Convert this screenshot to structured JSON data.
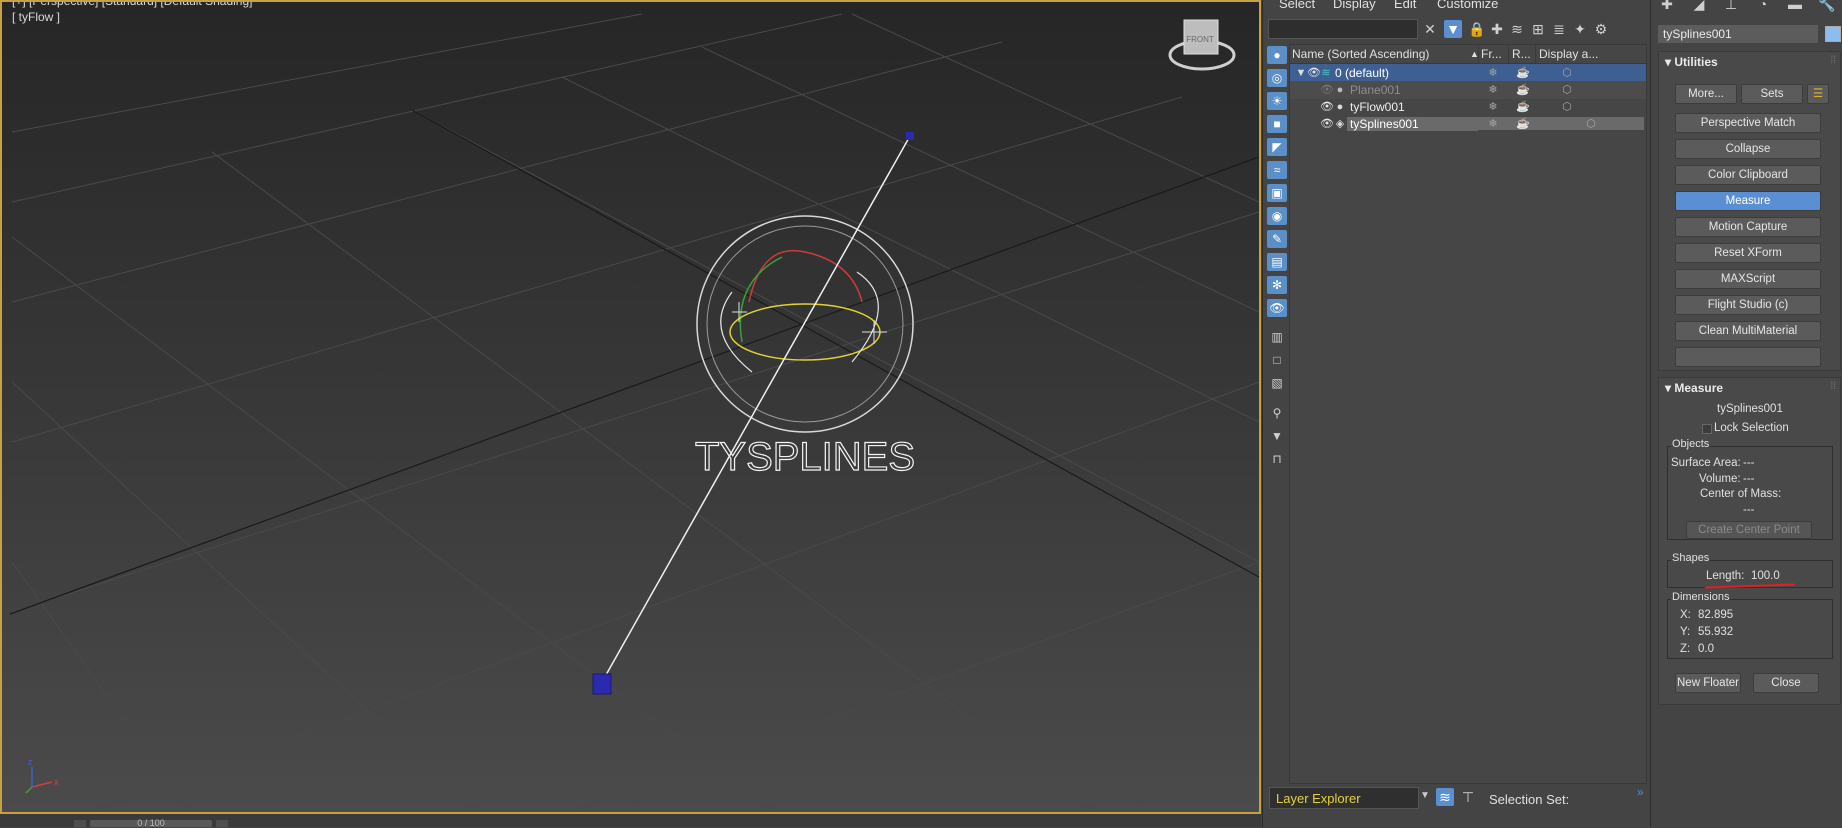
{
  "viewport": {
    "labels_line": "[+] [Perspective] [Standard] [Default Shading]",
    "label": "[ tyFlow ]",
    "logo_text": "TYSPLINES",
    "frame_counter": "0 / 100",
    "viewcube_text": "FRONT",
    "axis_labels": {
      "x": "x",
      "y": "y",
      "z": "z"
    }
  },
  "explorer": {
    "menu": [
      "Select",
      "Display",
      "Edit",
      "Customize"
    ],
    "search_placeholder": "",
    "columns": {
      "name": "Name (Sorted Ascending)",
      "frozen": "Fr...",
      "render": "R...",
      "display": "Display a..."
    },
    "rows": [
      {
        "name": "0 (default)",
        "level": 0,
        "type": "layer"
      },
      {
        "name": "Plane001",
        "level": 1,
        "type": "geometry",
        "hidden": true
      },
      {
        "name": "tyFlow001",
        "level": 1,
        "type": "geometry"
      },
      {
        "name": "tySplines001",
        "level": 1,
        "type": "shape",
        "selected": true
      }
    ],
    "layer_dropdown": "Layer Explorer",
    "selection_set_label": "Selection Set:"
  },
  "command_panel": {
    "object_name": "tySplines001",
    "swatch_color": "#8cbcf0",
    "utilities": {
      "title": "Utilities",
      "more_button": "More...",
      "sets_button": "Sets",
      "buttons": [
        "Perspective Match",
        "Collapse",
        "Color Clipboard",
        "Measure",
        "Motion Capture",
        "Reset XForm",
        "MAXScript",
        "Flight Studio (c)",
        "Clean MultiMaterial",
        ""
      ],
      "selected_button": "Measure"
    },
    "measure": {
      "title": "Measure",
      "object": "tySplines001",
      "lock_selection": "Lock Selection",
      "objects_group": "Objects",
      "surface_area_label": "Surface Area:",
      "surface_area_value": "---",
      "volume_label": "Volume:",
      "volume_value": "---",
      "center_of_mass_label": "Center of Mass:",
      "center_of_mass_value": "---",
      "create_center_point": "Create Center Point",
      "shapes_group": "Shapes",
      "length_label": "Length:",
      "length_value": "100.0",
      "dimensions_group": "Dimensions",
      "x_label": "X:",
      "x_value": "82.895",
      "y_label": "Y:",
      "y_value": "55.932",
      "z_label": "Z:",
      "z_value": "0.0",
      "new_floater": "New Floater",
      "close": "Close"
    }
  },
  "colors": {
    "accent": "#5b8fd4",
    "viewport_border": "#c8a04a",
    "layer_dropdown_text": "#e8d23a",
    "annotation_underline": "#e02020"
  }
}
